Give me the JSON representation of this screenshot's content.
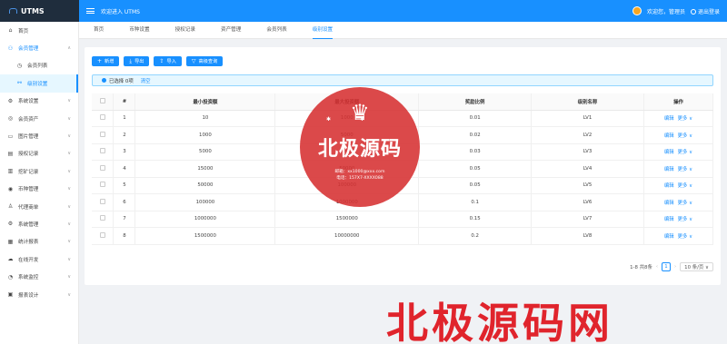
{
  "app": {
    "name": "UTMS",
    "welcome": "欢迎进入 UTMS"
  },
  "user": {
    "greeting": "欢迎您，管理员",
    "logout": "退出登录"
  },
  "sidebar": {
    "items": [
      {
        "label": "首页",
        "icon": "home-icon",
        "glyph": "⌂",
        "chevron": false
      },
      {
        "label": "会员管理",
        "icon": "user-icon",
        "glyph": "⚇",
        "chevron": true,
        "open": true
      },
      {
        "label": "会员列表",
        "icon": "clock-icon",
        "glyph": "◷",
        "sub": true
      },
      {
        "label": "级别设置",
        "icon": "users-icon",
        "glyph": "⚯",
        "sub": true,
        "active": true
      },
      {
        "label": "系统设置",
        "icon": "gear-icon",
        "glyph": "⚙",
        "chevron": true
      },
      {
        "label": "会员资产",
        "icon": "coin-icon",
        "glyph": "◎",
        "chevron": true
      },
      {
        "label": "图片管理",
        "icon": "image-icon",
        "glyph": "▭",
        "chevron": true
      },
      {
        "label": "授权记录",
        "icon": "doc-icon",
        "glyph": "▤",
        "chevron": true
      },
      {
        "label": "挖矿记录",
        "icon": "record-icon",
        "glyph": "▥",
        "chevron": true
      },
      {
        "label": "币种管理",
        "icon": "currency-icon",
        "glyph": "◉",
        "chevron": true
      },
      {
        "label": "代理商单",
        "icon": "agent-icon",
        "glyph": "♙",
        "chevron": true
      },
      {
        "label": "系统管理",
        "icon": "settings-icon",
        "glyph": "⚙",
        "chevron": true
      },
      {
        "label": "统计报表",
        "icon": "chart-icon",
        "glyph": "▦",
        "chevron": true
      },
      {
        "label": "在线开发",
        "icon": "cloud-icon",
        "glyph": "☁",
        "chevron": true
      },
      {
        "label": "系统监控",
        "icon": "monitor-icon",
        "glyph": "◔",
        "chevron": true
      },
      {
        "label": "报表设计",
        "icon": "report-icon",
        "glyph": "▣",
        "chevron": true
      }
    ]
  },
  "tabs": [
    "首页",
    "币种设置",
    "授权记录",
    "资产管理",
    "会员列表",
    "级别设置"
  ],
  "active_tab": 5,
  "toolbar": {
    "add": "新增",
    "export": "导出",
    "import": "导入",
    "advanced": "高级查询"
  },
  "selection": {
    "text": "已选择 0项",
    "clear": "清空"
  },
  "table": {
    "headers": [
      "#",
      "最小投资额",
      "最大投资额",
      "奖励比例",
      "级别名称",
      "操作"
    ],
    "rows": [
      [
        "1",
        "10",
        "1000",
        "0.01",
        "LV1"
      ],
      [
        "2",
        "1000",
        "5000",
        "0.02",
        "LV2"
      ],
      [
        "3",
        "5000",
        "15000",
        "0.03",
        "LV3"
      ],
      [
        "4",
        "15000",
        "50000",
        "0.05",
        "LV4"
      ],
      [
        "5",
        "50000",
        "100000",
        "0.05",
        "LV5"
      ],
      [
        "6",
        "100000",
        "1000000",
        "0.1",
        "LV6"
      ],
      [
        "7",
        "1000000",
        "1500000",
        "0.15",
        "LV7"
      ],
      [
        "8",
        "1500000",
        "10000000",
        "0.2",
        "LV8"
      ]
    ],
    "edit_label": "编辑",
    "more_label": "更多 ∨"
  },
  "pagination": {
    "summary": "1-8 共8条",
    "current": "1",
    "page_size": "10 条/页 ∨"
  },
  "watermark": {
    "seal_title": "北极源码",
    "seal_email": "邮箱：xx1000@xxx.com",
    "seal_phone": "电话：157X7-XXXX088",
    "big": "北极源码网"
  },
  "colors": {
    "primary": "#1890ff",
    "sidebar_header": "#1f2d3d",
    "watermark": "#d63031"
  }
}
